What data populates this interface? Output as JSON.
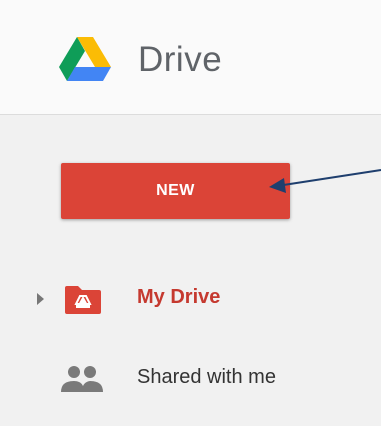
{
  "header": {
    "app_title": "Drive",
    "logo_icon": "google-drive-logo"
  },
  "new_button": {
    "label": "NEW",
    "color": "#db4437"
  },
  "annotation": {
    "arrow_color": "#1f3f6e"
  },
  "nav": {
    "items": [
      {
        "label": "My Drive",
        "icon": "my-drive-folder-icon",
        "active": true,
        "color": "#c5392f"
      },
      {
        "label": "Shared with me",
        "icon": "people-icon",
        "active": false
      }
    ]
  }
}
